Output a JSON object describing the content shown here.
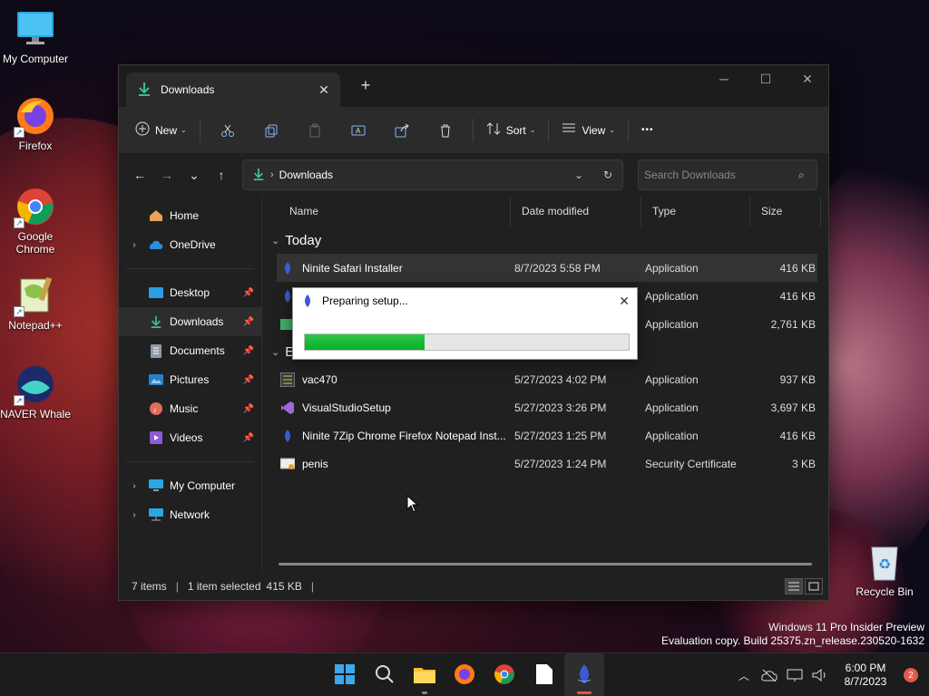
{
  "desktop": {
    "icons": [
      {
        "label": "My Computer",
        "icon": "monitor-icon"
      },
      {
        "label": "Firefox",
        "icon": "firefox-icon"
      },
      {
        "label": "Google Chrome",
        "icon": "chrome-icon"
      },
      {
        "label": "Notepad++",
        "icon": "notepadpp-icon"
      },
      {
        "label": "NAVER Whale",
        "icon": "whale-icon"
      },
      {
        "label": "Recycle Bin",
        "icon": "recycle-bin-icon"
      }
    ]
  },
  "window": {
    "tab_title": "Downloads",
    "new_tab": "+",
    "toolbar": {
      "new_label": "New",
      "sort_label": "Sort",
      "view_label": "View",
      "more": "•••"
    },
    "address": {
      "crumb": "Downloads",
      "search_placeholder": "Search Downloads"
    },
    "nav": {
      "home": "Home",
      "onedrive": "OneDrive",
      "desktop": "Desktop",
      "downloads": "Downloads",
      "documents": "Documents",
      "pictures": "Pictures",
      "music": "Music",
      "videos": "Videos",
      "my_computer": "My Computer",
      "network": "Network"
    },
    "columns": {
      "name": "Name",
      "date": "Date modified",
      "type": "Type",
      "size": "Size"
    },
    "groups": {
      "today": "Today",
      "earlier": "Ea"
    },
    "files": [
      {
        "name": "Ninite Safari Installer",
        "date": "8/7/2023 5:58 PM",
        "type": "Application",
        "size": "416 KB"
      },
      {
        "name": "",
        "date": "",
        "type": "Application",
        "size": "416 KB"
      },
      {
        "name": "",
        "date": "",
        "type": "Application",
        "size": "2,761 KB"
      },
      {
        "name": "vac470",
        "date": "5/27/2023 4:02 PM",
        "type": "Application",
        "size": "937 KB"
      },
      {
        "name": "VisualStudioSetup",
        "date": "5/27/2023 3:26 PM",
        "type": "Application",
        "size": "3,697 KB"
      },
      {
        "name": "Ninite 7Zip Chrome Firefox Notepad Inst...",
        "date": "5/27/2023 1:25 PM",
        "type": "Application",
        "size": "416 KB"
      },
      {
        "name": "penis",
        "date": "5/27/2023 1:24 PM",
        "type": "Security Certificate",
        "size": "3 KB"
      }
    ],
    "status": {
      "items": "7 items",
      "selected": "1 item selected",
      "size": "415 KB"
    }
  },
  "dialog": {
    "title": "Preparing setup...",
    "progress": 0.37
  },
  "watermark": {
    "line1": "Windows 11 Pro Insider Preview",
    "line2": "Evaluation copy. Build 25375.zn_release.230520-1632"
  },
  "taskbar": {
    "time": "6:00 PM",
    "date": "8/7/2023",
    "notifications": "2"
  }
}
